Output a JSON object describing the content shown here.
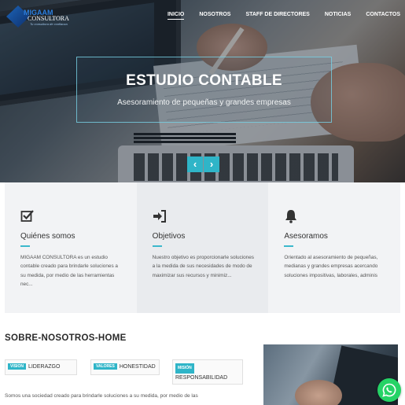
{
  "nav": {
    "logo_name": "MIGAAM",
    "logo_name2": "CONSULTORA",
    "logo_tagline": "Tu consultora de confianza",
    "menu": [
      {
        "label": "INICIO",
        "active": true
      },
      {
        "label": "NOSOTROS",
        "active": false
      },
      {
        "label": "STAFF DE DIRECTORES",
        "active": false
      },
      {
        "label": "NOTICIAS",
        "active": false
      },
      {
        "label": "CONTACTOS",
        "active": false
      }
    ]
  },
  "hero": {
    "title": "ESTUDIO CONTABLE",
    "subtitle": "Asesoramiento de pequeñas y grandes empresas",
    "prev_label": "‹",
    "next_label": "›"
  },
  "features": [
    {
      "icon": "checkbox-icon",
      "title": "Quiénes somos",
      "text": "MIGAAM CONSULTORA es un estudio contable creado para brindarle soluciones a su medida, por medio de las herramientas nec..."
    },
    {
      "icon": "sign-in-icon",
      "title": "Objetivos",
      "text": "Nuestro objetivo es proporcionarle soluciones a la medida de sus necesidades de modo de maximizar sus recursos y minimiz..."
    },
    {
      "icon": "bell-icon",
      "title": "Asesoramos",
      "text": "Orientado al asesoramiento de pequeñas, medianas y grandes empresas acercando soluciones impositivas, laborales, adminis"
    }
  ],
  "about": {
    "title": "SOBRE-NOSOTROS-HOME",
    "tags": [
      {
        "badge": "VISION",
        "label": "LIDERAZGO"
      },
      {
        "badge": "VALORES",
        "label": "HONESTIDAD"
      },
      {
        "badge": "MISIÓN",
        "label": "RESPONSABILIDAD"
      }
    ],
    "text": "Somos una sociedad creado para brindarle soluciones a su medida, por medio de las"
  },
  "colors": {
    "accent": "#2fb5c8",
    "whatsapp": "#25d366"
  }
}
